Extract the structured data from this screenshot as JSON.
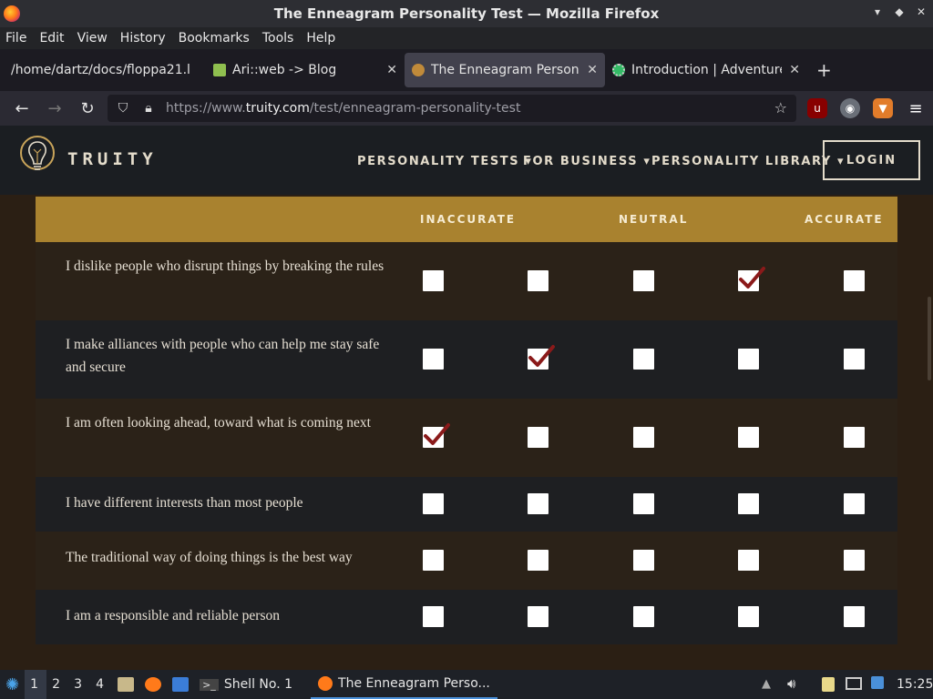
{
  "window": {
    "title": "The Enneagram Personality Test — Mozilla Firefox"
  },
  "menu": [
    "File",
    "Edit",
    "View",
    "History",
    "Bookmarks",
    "Tools",
    "Help"
  ],
  "tabs": [
    {
      "label": "/home/dartz/docs/floppa21.l",
      "active": false
    },
    {
      "label": "Ari::web -> Blog",
      "active": false
    },
    {
      "label": "The Enneagram Personal",
      "active": true
    },
    {
      "label": "Introduction | Adventurer",
      "active": false
    }
  ],
  "url": {
    "prefix": "https://www.",
    "domain": "truity.com",
    "path": "/test/enneagram-personality-test"
  },
  "site": {
    "brand": "TRUITY",
    "nav": [
      "PERSONALITY TESTS",
      "FOR BUSINESS",
      "PERSONALITY LIBRARY"
    ],
    "login": "LOGIN"
  },
  "scale": {
    "inaccurate": "INACCURATE",
    "neutral": "NEUTRAL",
    "accurate": "ACCURATE"
  },
  "questions": [
    {
      "text": "I dislike people who disrupt things by breaking the rules",
      "selected": 4
    },
    {
      "text": "I make alliances with people who can help me stay safe and secure",
      "selected": 2
    },
    {
      "text": "I am often looking ahead, toward what is coming next",
      "selected": 1
    },
    {
      "text": "I have different interests than most people",
      "selected": 0
    },
    {
      "text": "The traditional way of doing things is the best way",
      "selected": 0
    },
    {
      "text": "I am a responsible and reliable person",
      "selected": 0
    }
  ],
  "taskbar": {
    "workspaces": [
      "1",
      "2",
      "3",
      "4"
    ],
    "shell": "Shell No. 1",
    "task": "The Enneagram Perso...",
    "clock": "15:25"
  }
}
